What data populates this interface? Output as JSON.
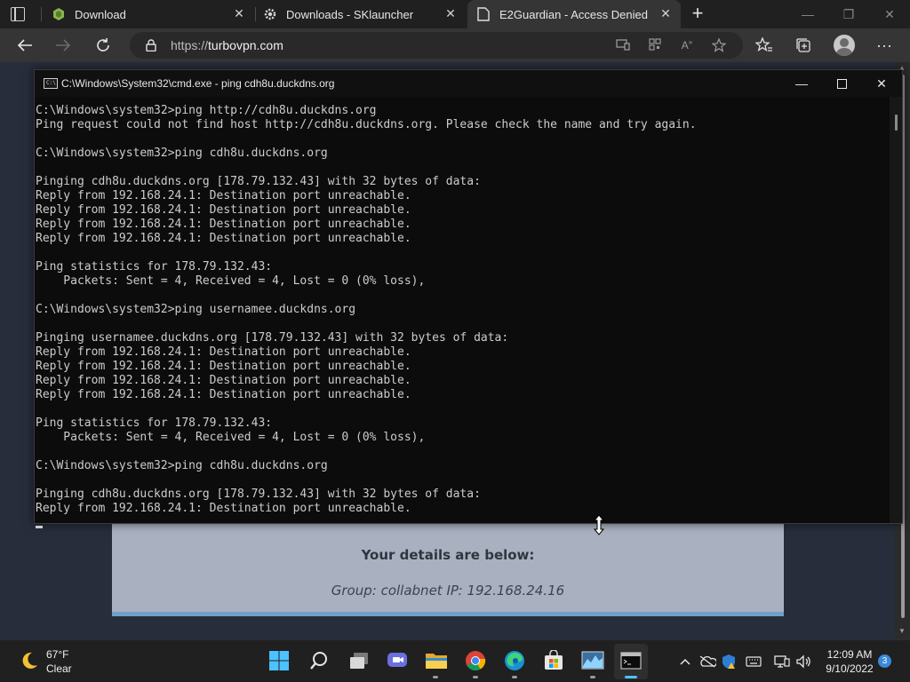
{
  "browser": {
    "tabs": [
      {
        "title": "Download",
        "active": false
      },
      {
        "title": "Downloads - SKlauncher",
        "active": false
      },
      {
        "title": "E2Guardian - Access Denied",
        "active": true
      }
    ],
    "new_tab_label": "+",
    "address": {
      "scheme": "https://",
      "host": "turbovpn.com"
    }
  },
  "page": {
    "details_heading": "Your details are below:",
    "group_ip": "Group: collabnet   IP: 192.168.24.16"
  },
  "cmd": {
    "title": "C:\\Windows\\System32\\cmd.exe - ping  cdh8u.duckdns.org",
    "lines": [
      "C:\\Windows\\system32>ping http://cdh8u.duckdns.org",
      "Ping request could not find host http://cdh8u.duckdns.org. Please check the name and try again.",
      "",
      "C:\\Windows\\system32>ping cdh8u.duckdns.org",
      "",
      "Pinging cdh8u.duckdns.org [178.79.132.43] with 32 bytes of data:",
      "Reply from 192.168.24.1: Destination port unreachable.",
      "Reply from 192.168.24.1: Destination port unreachable.",
      "Reply from 192.168.24.1: Destination port unreachable.",
      "Reply from 192.168.24.1: Destination port unreachable.",
      "",
      "Ping statistics for 178.79.132.43:",
      "    Packets: Sent = 4, Received = 4, Lost = 0 (0% loss),",
      "",
      "C:\\Windows\\system32>ping usernamee.duckdns.org",
      "",
      "Pinging usernamee.duckdns.org [178.79.132.43] with 32 bytes of data:",
      "Reply from 192.168.24.1: Destination port unreachable.",
      "Reply from 192.168.24.1: Destination port unreachable.",
      "Reply from 192.168.24.1: Destination port unreachable.",
      "Reply from 192.168.24.1: Destination port unreachable.",
      "",
      "Ping statistics for 178.79.132.43:",
      "    Packets: Sent = 4, Received = 4, Lost = 0 (0% loss),",
      "",
      "C:\\Windows\\system32>ping cdh8u.duckdns.org",
      "",
      "Pinging cdh8u.duckdns.org [178.79.132.43] with 32 bytes of data:",
      "Reply from 192.168.24.1: Destination port unreachable."
    ]
  },
  "taskbar": {
    "weather": {
      "temp": "67°F",
      "condition": "Clear",
      "icon": "moon-icon"
    },
    "apps": [
      "start",
      "search",
      "task-view",
      "teams-chat",
      "file-explorer",
      "chrome",
      "edge",
      "microsoft-store",
      "resource-monitor",
      "terminal"
    ],
    "clock": {
      "time": "12:09 AM",
      "date": "9/10/2022"
    },
    "notification_count": "3"
  },
  "colors": {
    "taskbar_active_indicator": "#4cc2ff",
    "page_background": "#272d3a",
    "card_background": "#a9b1c0"
  }
}
